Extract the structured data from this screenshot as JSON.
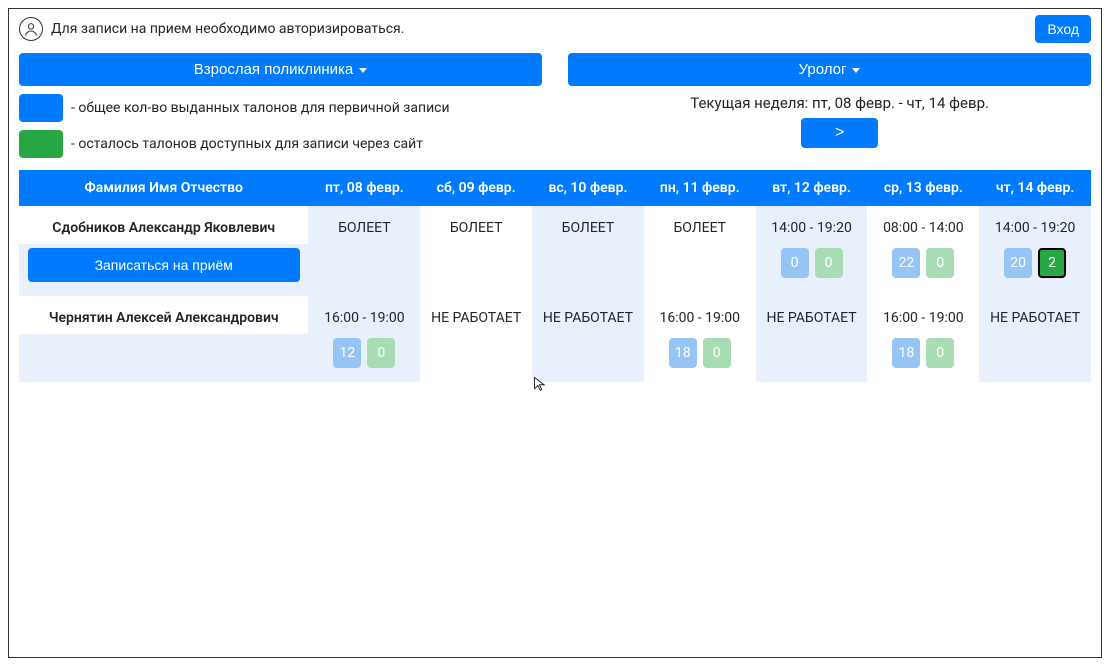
{
  "header": {
    "auth_notice": "Для записи на прием необходимо авторизироваться.",
    "login_label": "Вход"
  },
  "filters": {
    "clinic_label": "Взрослая поликлиника",
    "specialty_label": "Уролог"
  },
  "legend": {
    "issued": "- общее кол-во выданных талонов для первичной записи",
    "available": "- осталось талонов доступных для записи через сайт"
  },
  "week": {
    "label": "Текущая неделя: пт, 08 февр. - чт, 14 февр.",
    "next": ">"
  },
  "table": {
    "col_name": "Фамилия Имя Отчество",
    "days": [
      "пт, 08 февр.",
      "сб, 09 февр.",
      "вс, 10 февр.",
      "пн, 11 февр.",
      "вт, 12 февр.",
      "ср, 13 февр.",
      "чт, 14 февр."
    ],
    "book_label": "Записаться на приём",
    "doctors": [
      {
        "name": "Сдобников Александр Яковлевич",
        "cells": [
          {
            "shade": true,
            "text": "БОЛЕЕТ"
          },
          {
            "shade": false,
            "text": "БОЛЕЕТ"
          },
          {
            "shade": true,
            "text": "БОЛЕЕТ"
          },
          {
            "shade": false,
            "text": "БОЛЕЕТ"
          },
          {
            "shade": true,
            "text": "14:00 - 19:20",
            "issued": 0,
            "available": 0
          },
          {
            "shade": false,
            "text": "08:00 - 14:00",
            "issued": 22,
            "available": 0
          },
          {
            "shade": true,
            "text": "14:00 - 19:20",
            "issued": 20,
            "available": 2,
            "available_highlight": true
          }
        ],
        "show_book": true
      },
      {
        "name": "Чернятин Алексей Александрович",
        "cells": [
          {
            "shade": true,
            "text": "16:00 - 19:00",
            "issued": 12,
            "available": 0
          },
          {
            "shade": false,
            "text": "НЕ РАБОТАЕТ"
          },
          {
            "shade": true,
            "text": "НЕ РАБОТАЕТ"
          },
          {
            "shade": false,
            "text": "16:00 - 19:00",
            "issued": 18,
            "available": 0
          },
          {
            "shade": true,
            "text": "НЕ РАБОТАЕТ"
          },
          {
            "shade": false,
            "text": "16:00 - 19:00",
            "issued": 18,
            "available": 0
          },
          {
            "shade": true,
            "text": "НЕ РАБОТАЕТ"
          }
        ],
        "show_book": false
      }
    ]
  }
}
